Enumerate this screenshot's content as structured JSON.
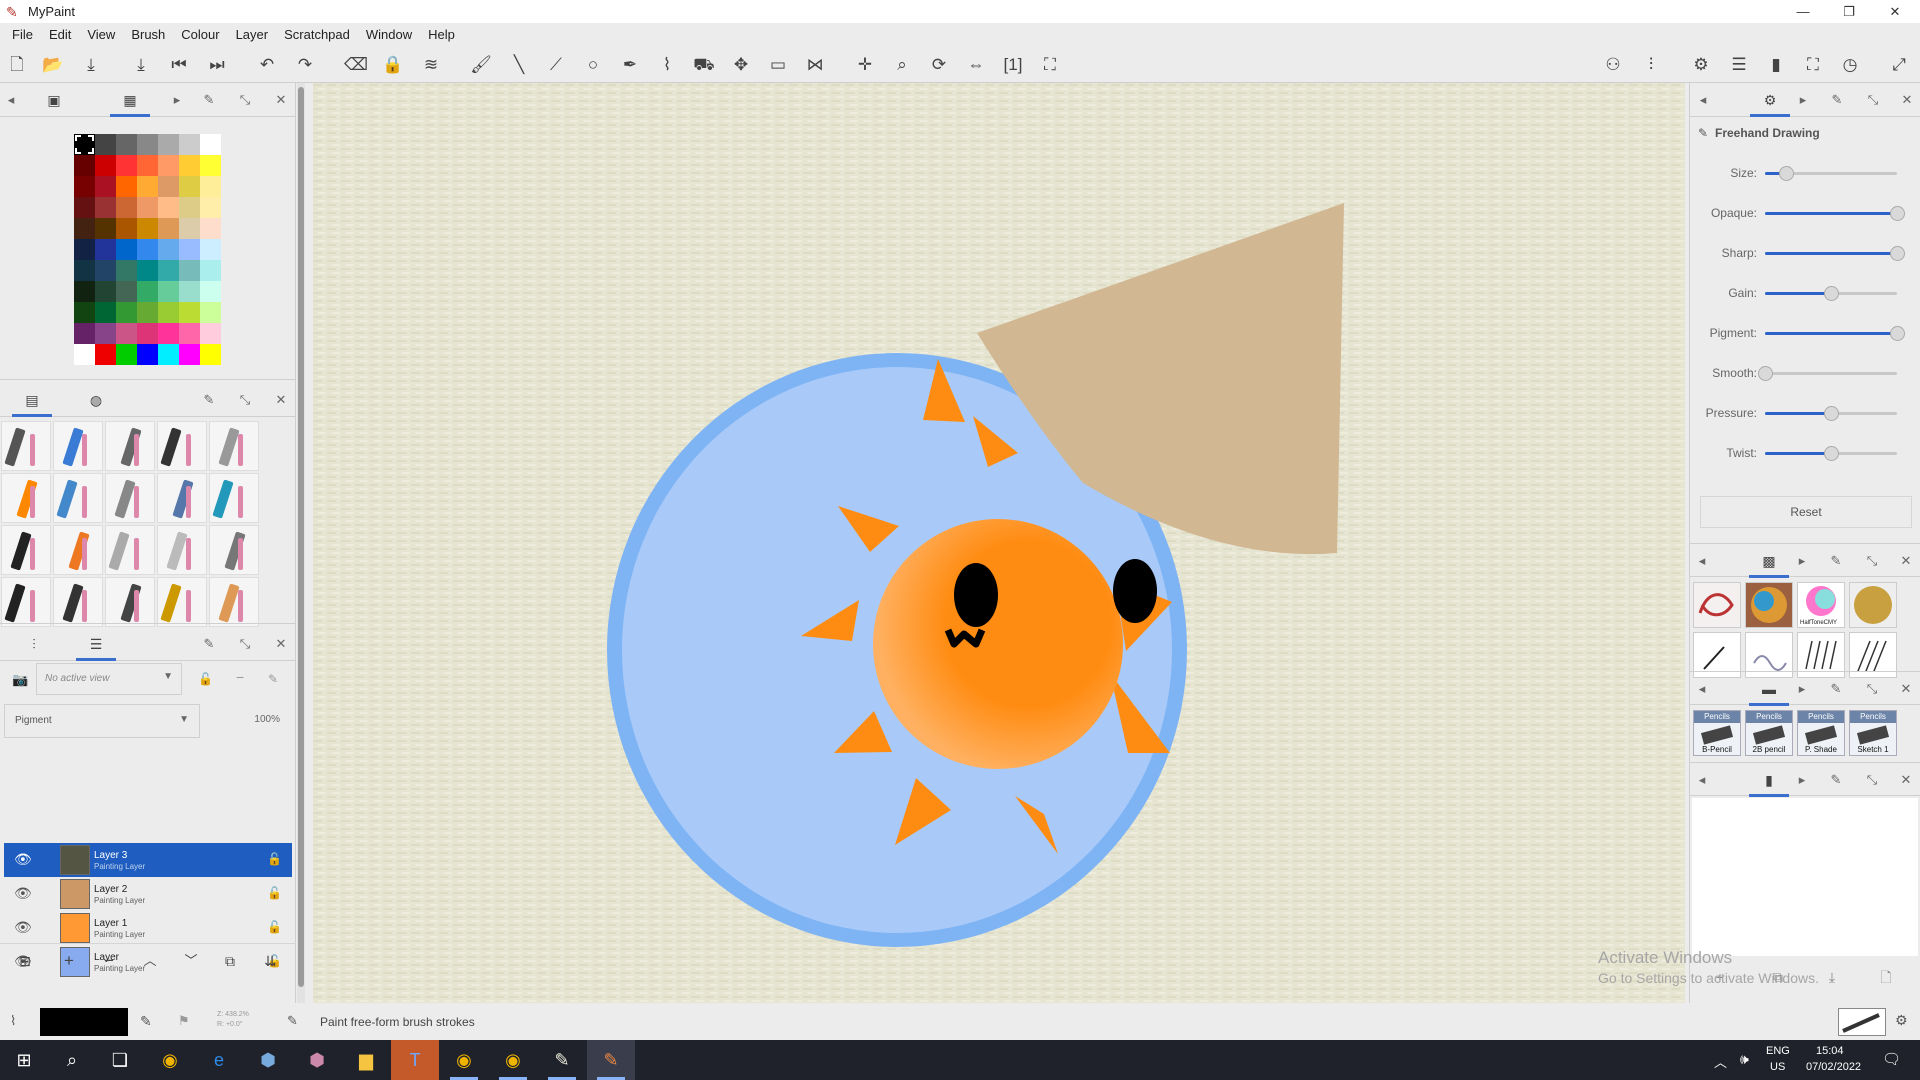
{
  "window": {
    "title": "MyPaint",
    "minimize": "—",
    "restore": "❐",
    "close": "✕"
  },
  "menu": [
    "File",
    "Edit",
    "View",
    "Brush",
    "Colour",
    "Layer",
    "Scratchpad",
    "Window",
    "Help"
  ],
  "tool_options": {
    "title": "Freehand Drawing",
    "sliders": [
      {
        "label": "Size:",
        "value": 0.16
      },
      {
        "label": "Opaque:",
        "value": 1.0
      },
      {
        "label": "Sharp:",
        "value": 1.0
      },
      {
        "label": "Gain:",
        "value": 0.5
      },
      {
        "label": "Pigment:",
        "value": 1.0
      },
      {
        "label": "Smooth:",
        "value": 0.0
      },
      {
        "label": "Pressure:",
        "value": 0.5
      },
      {
        "label": "Twist:",
        "value": 0.5
      }
    ],
    "reset_label": "Reset"
  },
  "layers_panel": {
    "view_placeholder": "No active view",
    "mode": "Pigment",
    "opacity": "100%",
    "layers": [
      {
        "name": "Layer 3",
        "type": "Painting Layer",
        "selected": true
      },
      {
        "name": "Layer 2",
        "type": "Painting Layer",
        "selected": false
      },
      {
        "name": "Layer 1",
        "type": "Painting Layer",
        "selected": false
      },
      {
        "name": "Layer",
        "type": "Painting Layer",
        "selected": false
      }
    ]
  },
  "brush_presets_right": [
    "B-Pencil",
    "2B pencil",
    "P. Shade",
    "Sketch 1"
  ],
  "brush_presets_right_header": "Pencils",
  "brush_presets_right_halftone": "HalfToneCMY",
  "status": {
    "zoom": "Z: 438.2%",
    "rotation": "R: +0.0°",
    "message": "Paint free-form brush strokes"
  },
  "watermark": {
    "line1": "Activate Windows",
    "line2": "Go to Settings to activate Windows."
  },
  "taskbar": {
    "language": "ENG",
    "region": "US",
    "time": "15:04",
    "date": "07/02/2022"
  },
  "colors": {
    "accent": "#1f5ec0",
    "canvas_paper": "#e4e3cf",
    "taskbar": "#20222b"
  }
}
